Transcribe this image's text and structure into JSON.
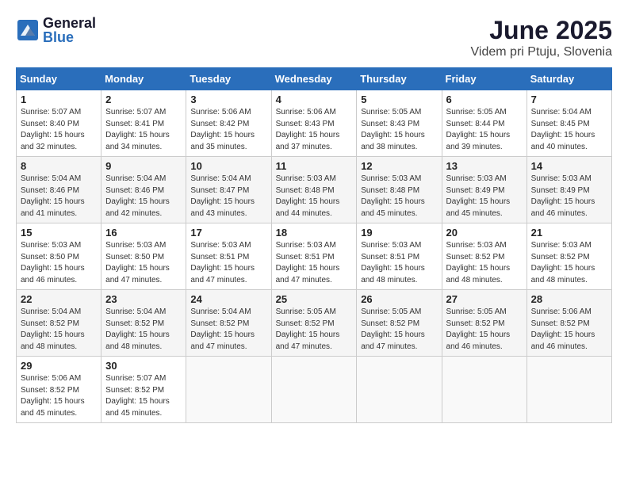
{
  "header": {
    "logo_general": "General",
    "logo_blue": "Blue",
    "month_title": "June 2025",
    "location": "Videm pri Ptuju, Slovenia"
  },
  "weekdays": [
    "Sunday",
    "Monday",
    "Tuesday",
    "Wednesday",
    "Thursday",
    "Friday",
    "Saturday"
  ],
  "weeks": [
    [
      {
        "day": "1",
        "sunrise": "5:07 AM",
        "sunset": "8:40 PM",
        "daylight": "15 hours and 32 minutes."
      },
      {
        "day": "2",
        "sunrise": "5:07 AM",
        "sunset": "8:41 PM",
        "daylight": "15 hours and 34 minutes."
      },
      {
        "day": "3",
        "sunrise": "5:06 AM",
        "sunset": "8:42 PM",
        "daylight": "15 hours and 35 minutes."
      },
      {
        "day": "4",
        "sunrise": "5:06 AM",
        "sunset": "8:43 PM",
        "daylight": "15 hours and 37 minutes."
      },
      {
        "day": "5",
        "sunrise": "5:05 AM",
        "sunset": "8:43 PM",
        "daylight": "15 hours and 38 minutes."
      },
      {
        "day": "6",
        "sunrise": "5:05 AM",
        "sunset": "8:44 PM",
        "daylight": "15 hours and 39 minutes."
      },
      {
        "day": "7",
        "sunrise": "5:04 AM",
        "sunset": "8:45 PM",
        "daylight": "15 hours and 40 minutes."
      }
    ],
    [
      {
        "day": "8",
        "sunrise": "5:04 AM",
        "sunset": "8:46 PM",
        "daylight": "15 hours and 41 minutes."
      },
      {
        "day": "9",
        "sunrise": "5:04 AM",
        "sunset": "8:46 PM",
        "daylight": "15 hours and 42 minutes."
      },
      {
        "day": "10",
        "sunrise": "5:04 AM",
        "sunset": "8:47 PM",
        "daylight": "15 hours and 43 minutes."
      },
      {
        "day": "11",
        "sunrise": "5:03 AM",
        "sunset": "8:48 PM",
        "daylight": "15 hours and 44 minutes."
      },
      {
        "day": "12",
        "sunrise": "5:03 AM",
        "sunset": "8:48 PM",
        "daylight": "15 hours and 45 minutes."
      },
      {
        "day": "13",
        "sunrise": "5:03 AM",
        "sunset": "8:49 PM",
        "daylight": "15 hours and 45 minutes."
      },
      {
        "day": "14",
        "sunrise": "5:03 AM",
        "sunset": "8:49 PM",
        "daylight": "15 hours and 46 minutes."
      }
    ],
    [
      {
        "day": "15",
        "sunrise": "5:03 AM",
        "sunset": "8:50 PM",
        "daylight": "15 hours and 46 minutes."
      },
      {
        "day": "16",
        "sunrise": "5:03 AM",
        "sunset": "8:50 PM",
        "daylight": "15 hours and 47 minutes."
      },
      {
        "day": "17",
        "sunrise": "5:03 AM",
        "sunset": "8:51 PM",
        "daylight": "15 hours and 47 minutes."
      },
      {
        "day": "18",
        "sunrise": "5:03 AM",
        "sunset": "8:51 PM",
        "daylight": "15 hours and 47 minutes."
      },
      {
        "day": "19",
        "sunrise": "5:03 AM",
        "sunset": "8:51 PM",
        "daylight": "15 hours and 48 minutes."
      },
      {
        "day": "20",
        "sunrise": "5:03 AM",
        "sunset": "8:52 PM",
        "daylight": "15 hours and 48 minutes."
      },
      {
        "day": "21",
        "sunrise": "5:03 AM",
        "sunset": "8:52 PM",
        "daylight": "15 hours and 48 minutes."
      }
    ],
    [
      {
        "day": "22",
        "sunrise": "5:04 AM",
        "sunset": "8:52 PM",
        "daylight": "15 hours and 48 minutes."
      },
      {
        "day": "23",
        "sunrise": "5:04 AM",
        "sunset": "8:52 PM",
        "daylight": "15 hours and 48 minutes."
      },
      {
        "day": "24",
        "sunrise": "5:04 AM",
        "sunset": "8:52 PM",
        "daylight": "15 hours and 47 minutes."
      },
      {
        "day": "25",
        "sunrise": "5:05 AM",
        "sunset": "8:52 PM",
        "daylight": "15 hours and 47 minutes."
      },
      {
        "day": "26",
        "sunrise": "5:05 AM",
        "sunset": "8:52 PM",
        "daylight": "15 hours and 47 minutes."
      },
      {
        "day": "27",
        "sunrise": "5:05 AM",
        "sunset": "8:52 PM",
        "daylight": "15 hours and 46 minutes."
      },
      {
        "day": "28",
        "sunrise": "5:06 AM",
        "sunset": "8:52 PM",
        "daylight": "15 hours and 46 minutes."
      }
    ],
    [
      {
        "day": "29",
        "sunrise": "5:06 AM",
        "sunset": "8:52 PM",
        "daylight": "15 hours and 45 minutes."
      },
      {
        "day": "30",
        "sunrise": "5:07 AM",
        "sunset": "8:52 PM",
        "daylight": "15 hours and 45 minutes."
      },
      null,
      null,
      null,
      null,
      null
    ]
  ]
}
